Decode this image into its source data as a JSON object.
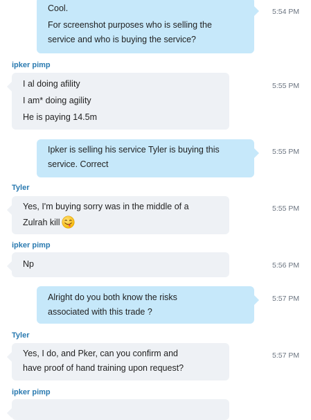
{
  "conversation": {
    "messages": [
      {
        "direction": "out",
        "sender": "",
        "lines": [
          "Cool.",
          "For screenshot purposes who is selling the",
          "service and who is buying the service?"
        ],
        "time": "5:54 PM"
      },
      {
        "direction": "in",
        "sender": "ipker pimp",
        "lines": [
          "I al doing afility",
          "I am* doing agility",
          "He is paying 14.5m"
        ],
        "time": "5:55 PM"
      },
      {
        "direction": "out",
        "sender": "",
        "lines": [
          "Ipker is selling his service Tyler is buying this",
          "service. Correct"
        ],
        "time": "5:55 PM"
      },
      {
        "direction": "in",
        "sender": "Tyler",
        "lines": [
          "Yes, I'm buying sorry was in the middle of a",
          "Zulrah kill"
        ],
        "emoji": "smiling-tongue-emoji",
        "time": "5:55 PM"
      },
      {
        "direction": "in",
        "sender": "ipker pimp",
        "lines": [
          "Np"
        ],
        "time": "5:56 PM"
      },
      {
        "direction": "out",
        "sender": "",
        "lines": [
          "Alright do you both know the risks",
          "associated with this trade ?"
        ],
        "time": "5:57 PM"
      },
      {
        "direction": "in",
        "sender": "Tyler",
        "lines": [
          "Yes, I do, and Pker, can you confirm and",
          "have proof of hand training upon request?"
        ],
        "time": "5:57 PM"
      },
      {
        "direction": "in",
        "sender": "ipker pimp",
        "lines": [],
        "time": ""
      }
    ]
  },
  "colors": {
    "outgoing_bubble": "#c6e8fa",
    "incoming_bubble": "#eef1f5",
    "sender_name": "#2a7ab0",
    "timestamp": "#6b7480"
  }
}
